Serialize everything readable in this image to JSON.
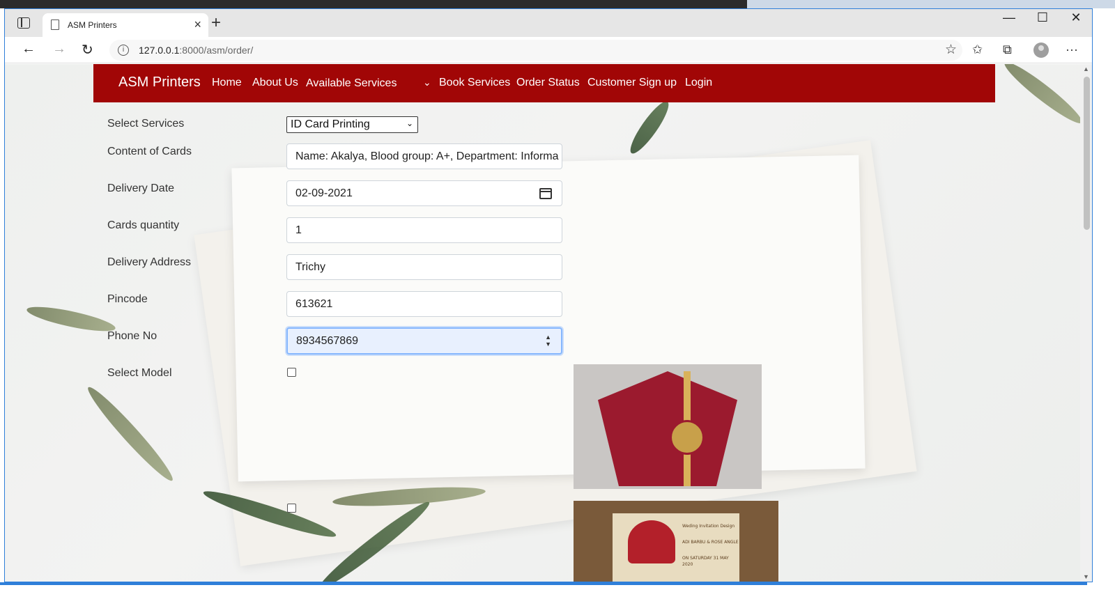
{
  "browser": {
    "tab_title": "ASM Printers",
    "url_host": "127.0.0.1",
    "url_rest": ":8000/asm/order/"
  },
  "site": {
    "brand": "ASM Printers",
    "nav": [
      "Home",
      "About Us",
      "Available Services",
      "Book Services",
      "Order Status",
      "Customer Sign up",
      "Login"
    ],
    "primary_color": "#a10606"
  },
  "form": {
    "labels": {
      "service": "Select Services",
      "content": "Content of Cards",
      "date": "Delivery Date",
      "quantity": "Cards quantity",
      "address": "Delivery Address",
      "pincode": "Pincode",
      "phone": "Phone No",
      "model": "Select Model"
    },
    "values": {
      "service": "ID Card Printing",
      "content": "Name: Akalya, Blood group: A+, Department: Informa",
      "date": "02-09-2021",
      "quantity": "1",
      "address": "Trichy",
      "pincode": "613621",
      "phone": "8934567869"
    }
  },
  "models": {
    "card2_lines": [
      "Weding Invitation Design",
      "ADI BARBU & ROSE ANGLE",
      "ON SATURDAY 31 MAY 2020"
    ]
  }
}
